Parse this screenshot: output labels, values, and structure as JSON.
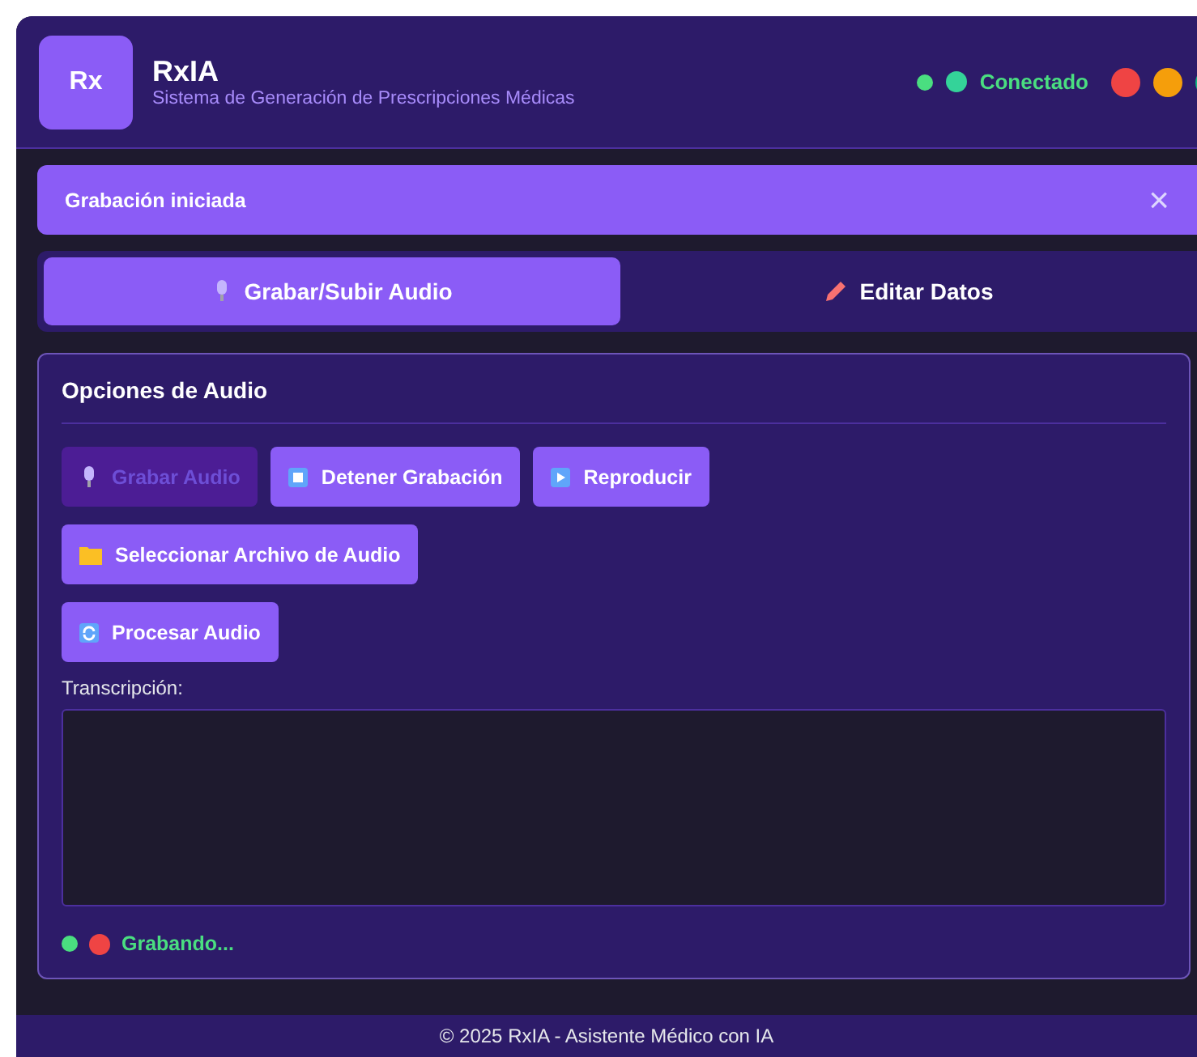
{
  "header": {
    "logo": "Rx",
    "title": "RxIA",
    "subtitle": "Sistema de Generación de Prescripciones Médicas",
    "status": {
      "text": "Conectado",
      "connected": true
    },
    "window_dots": [
      {
        "color": "#ef4444"
      },
      {
        "color": "#f59e0b"
      },
      {
        "color": "#10b981"
      }
    ]
  },
  "notification": {
    "text": "Grabación iniciada",
    "close": "×"
  },
  "tabs": [
    {
      "label": "Grabar/Subir Audio",
      "kind": "mic",
      "selected": true
    },
    {
      "label": "Editar Datos",
      "kind": "pencil",
      "selected": false
    }
  ],
  "panel": {
    "title": "Opciones de Audio",
    "button_rows": [
      [
        {
          "label": "Grabar Audio",
          "kind": "mic",
          "disabled": true
        },
        {
          "label": "Detener Grabación",
          "kind": "stop",
          "disabled": false
        },
        {
          "label": "Reproducir",
          "kind": "play",
          "disabled": false
        }
      ],
      [
        {
          "label": "Seleccionar Archivo de Audio",
          "kind": "folder",
          "disabled": false
        }
      ],
      [
        {
          "label": "Procesar Audio",
          "kind": "refresh",
          "disabled": false
        }
      ]
    ],
    "transcription_label": "Transcripción:",
    "recording": {
      "text": "Grabando...",
      "active": true
    }
  },
  "footer": "© 2025 RxIA - Asistente Médico con IA"
}
